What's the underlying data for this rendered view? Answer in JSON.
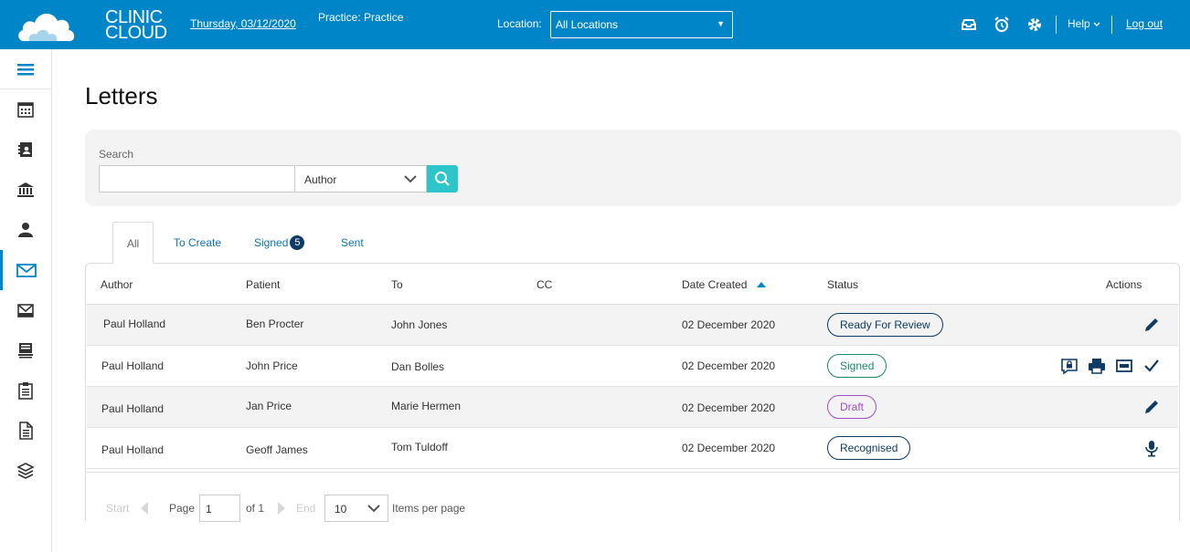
{
  "header": {
    "logo_line1": "CLINIC",
    "logo_line2": "CLOUD",
    "date": "Thursday, 03/12/2020",
    "practice": "Practice: Practice",
    "location_label": "Location:",
    "location_value": "All Locations",
    "help": "Help",
    "logout": "Log out",
    "brand_color": "#0086c8"
  },
  "sidebar": {
    "items": [
      {
        "icon": "menu-icon"
      },
      {
        "icon": "calendar-icon"
      },
      {
        "icon": "contacts-icon"
      },
      {
        "icon": "bank-icon"
      },
      {
        "icon": "person-icon"
      },
      {
        "icon": "mail-icon",
        "active": true
      },
      {
        "icon": "inbox-mail-icon"
      },
      {
        "icon": "stack-icon"
      },
      {
        "icon": "clipboard-icon"
      },
      {
        "icon": "document-icon"
      },
      {
        "icon": "layers-icon"
      }
    ]
  },
  "page": {
    "title": "Letters"
  },
  "search": {
    "label": "Search",
    "value": "",
    "field": "Author"
  },
  "tabs": [
    {
      "label": "All",
      "active": true
    },
    {
      "label": "To Create"
    },
    {
      "label": "Signed",
      "badge": "5"
    },
    {
      "label": "Sent"
    }
  ],
  "table": {
    "columns": [
      "Author",
      "Patient",
      "To",
      "CC",
      "Date Created",
      "Status",
      "Actions"
    ],
    "sort_column": "Date Created",
    "sort_dir": "asc",
    "rows": [
      {
        "author": "Paul Holland",
        "patient": "Ben Procter",
        "to": "John Jones",
        "cc": "",
        "date": "02 December 2020",
        "status": "Ready For Review",
        "status_color": "#0d3b66",
        "actions": [
          "edit-icon"
        ]
      },
      {
        "author": "Paul Holland",
        "patient": "John Price",
        "to": "Dan Bolles",
        "cc": "",
        "date": "02 December 2020",
        "status": "Signed",
        "status_color": "#1a8a6a",
        "actions": [
          "lock-message-icon",
          "print-icon",
          "minus-box-icon",
          "checkmark-icon"
        ]
      },
      {
        "author": "Paul Holland",
        "patient": "Jan Price",
        "to": "Marie Hermen",
        "cc": "",
        "date": "02 December 2020",
        "status": "Draft",
        "status_color": "#9b4fc9",
        "actions": [
          "edit-icon"
        ]
      },
      {
        "author": "Paul Holland",
        "patient": "Geoff James",
        "to": "Tom Tuldoff",
        "cc": "",
        "date": "02 December 2020",
        "status": "Recognised",
        "status_color": "#0d3b66",
        "actions": [
          "microphone-icon"
        ]
      }
    ]
  },
  "pager": {
    "start": "Start",
    "page_label": "Page",
    "page": "1",
    "of": "of 1",
    "end": "End",
    "page_size": "10",
    "per_page": "Items per page"
  }
}
